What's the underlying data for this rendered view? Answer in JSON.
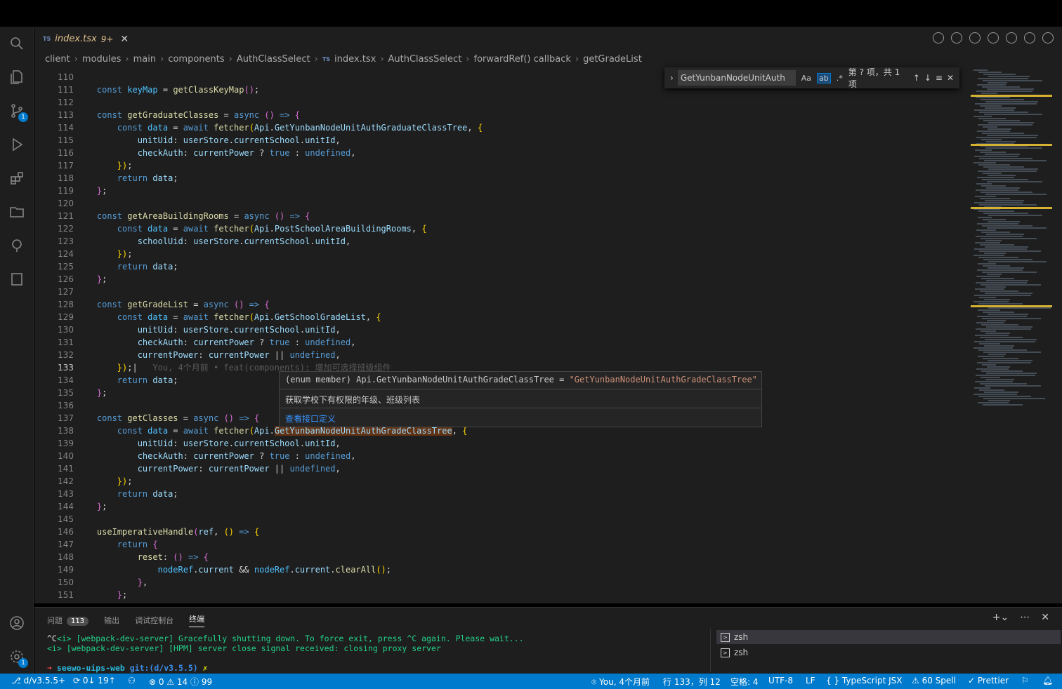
{
  "tab": {
    "lang": "TS",
    "name": "index.tsx",
    "problems": "9+",
    "close": "✕"
  },
  "breadcrumb": [
    "client",
    "modules",
    "main",
    "components",
    "AuthClassSelect",
    "index.tsx",
    "AuthClassSelect",
    "forwardRef() callback",
    "getGradeList"
  ],
  "activity": {
    "scm_badge": "1",
    "settings_badge": "1"
  },
  "find": {
    "value": "GetYunbanNodeUnitAuth",
    "opt_case": "Aa",
    "opt_word": "ab",
    "opt_regex": ".*",
    "result": "第 ? 项，共 1 项"
  },
  "lines": [
    "110",
    "111",
    "112",
    "113",
    "114",
    "115",
    "116",
    "117",
    "118",
    "119",
    "120",
    "121",
    "122",
    "123",
    "124",
    "125",
    "126",
    "127",
    "128",
    "129",
    "130",
    "131",
    "132",
    "133",
    "134",
    "135",
    "136",
    "137",
    "138",
    "139",
    "140",
    "141",
    "142",
    "143",
    "144",
    "145",
    "146",
    "147",
    "148",
    "149",
    "150",
    "151"
  ],
  "current_line": "133",
  "hover": {
    "signature": "(enum member) Api.GetYunbanNodeUnitAuthGradeClassTree = \"GetYunbanNodeUnitAuthGradeClassTree\"",
    "doc": "获取学校下有权限的年级、班级列表",
    "link": "查看接口定义"
  },
  "blame": "You, 4个月前 • feat(components): 增加可选择班级组件",
  "panel": {
    "tabs": [
      "问题",
      "输出",
      "调试控制台",
      "终端"
    ],
    "problem_count": "113",
    "term_line1": "^C<i> [webpack-dev-server] Gracefully shutting down. To force exit, press ^C again. Please wait...",
    "term_line2": "<i> [webpack-dev-server] [HPM] server close signal received: closing proxy server",
    "prompt_dir": "seewo-uips-web",
    "prompt_git": "git:(d/v3.5.5)",
    "prompt_mark": "✗",
    "terminals": [
      "zsh",
      "zsh"
    ]
  },
  "status": {
    "branch": "d/v3.5.5+",
    "sync": "0↓ 19↑",
    "errors": "0",
    "warnings": "14",
    "infos": "99",
    "blame": "You, 4个月前",
    "position": "行 133，列 12",
    "spaces": "空格: 4",
    "encoding": "UTF-8",
    "eol": "LF",
    "language": "TypeScript JSX",
    "spell": "60 Spell",
    "prettier": "Prettier"
  }
}
